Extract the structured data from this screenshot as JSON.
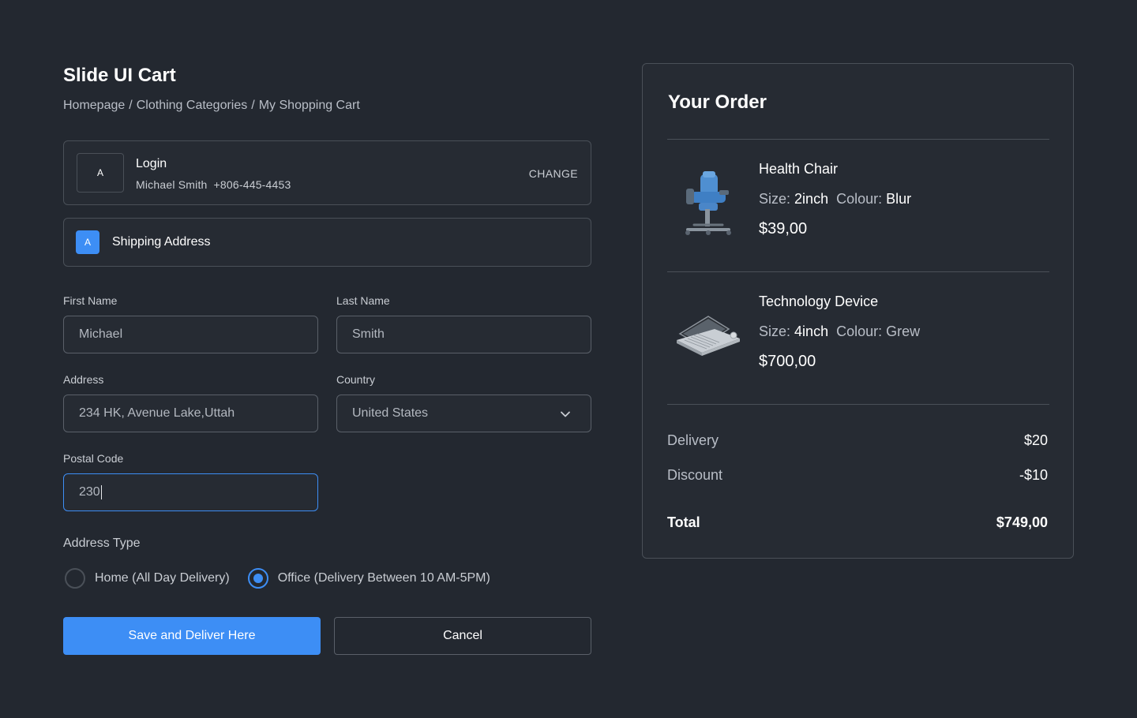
{
  "header": {
    "title": "Slide UI Cart",
    "breadcrumb": [
      "Homepage",
      "Clothing Categories",
      "My Shopping Cart"
    ],
    "separator": "/"
  },
  "login": {
    "badge": "A",
    "title": "Login",
    "name": "Michael Smith",
    "phone": "+806-445-4453",
    "change_label": "CHANGE"
  },
  "shipping": {
    "badge": "A",
    "title": "Shipping Address"
  },
  "form": {
    "first_name": {
      "label": "First Name",
      "value": "Michael"
    },
    "last_name": {
      "label": "Last Name",
      "value": "Smith"
    },
    "address": {
      "label": "Address",
      "value": "234 HK, Avenue Lake,Uttah"
    },
    "country": {
      "label": "Country",
      "value": "United States",
      "icon": "chevron-down-icon"
    },
    "postal_code": {
      "label": "Postal Code",
      "value": "230"
    },
    "address_type": {
      "label": "Address Type",
      "options": [
        {
          "label": "Home (All Day Delivery)",
          "checked": false
        },
        {
          "label": "Office (Delivery Between 10 AM-5PM)",
          "checked": true
        }
      ]
    },
    "save_label": "Save and Deliver Here",
    "cancel_label": "Cancel"
  },
  "order": {
    "title": "Your Order",
    "items": [
      {
        "name": "Health Chair",
        "size_label": "Size:",
        "size": "2inch",
        "colour_label": "Colour:",
        "colour": "Blur",
        "price": "$39,00",
        "icon": "chair-image"
      },
      {
        "name": "Technology Device",
        "size_label": "Size:",
        "size": "4inch",
        "colour_label": "Colour:",
        "colour": "Grew",
        "price": "$700,00",
        "icon": "laptop-image"
      }
    ],
    "summary": {
      "delivery_label": "Delivery",
      "delivery": "$20",
      "discount_label": "Discount",
      "discount": "-$10",
      "total_label": "Total",
      "total": "$749,00"
    }
  },
  "colors": {
    "background": "#232830",
    "accent": "#3d8ef5",
    "border": "#4a5058"
  }
}
